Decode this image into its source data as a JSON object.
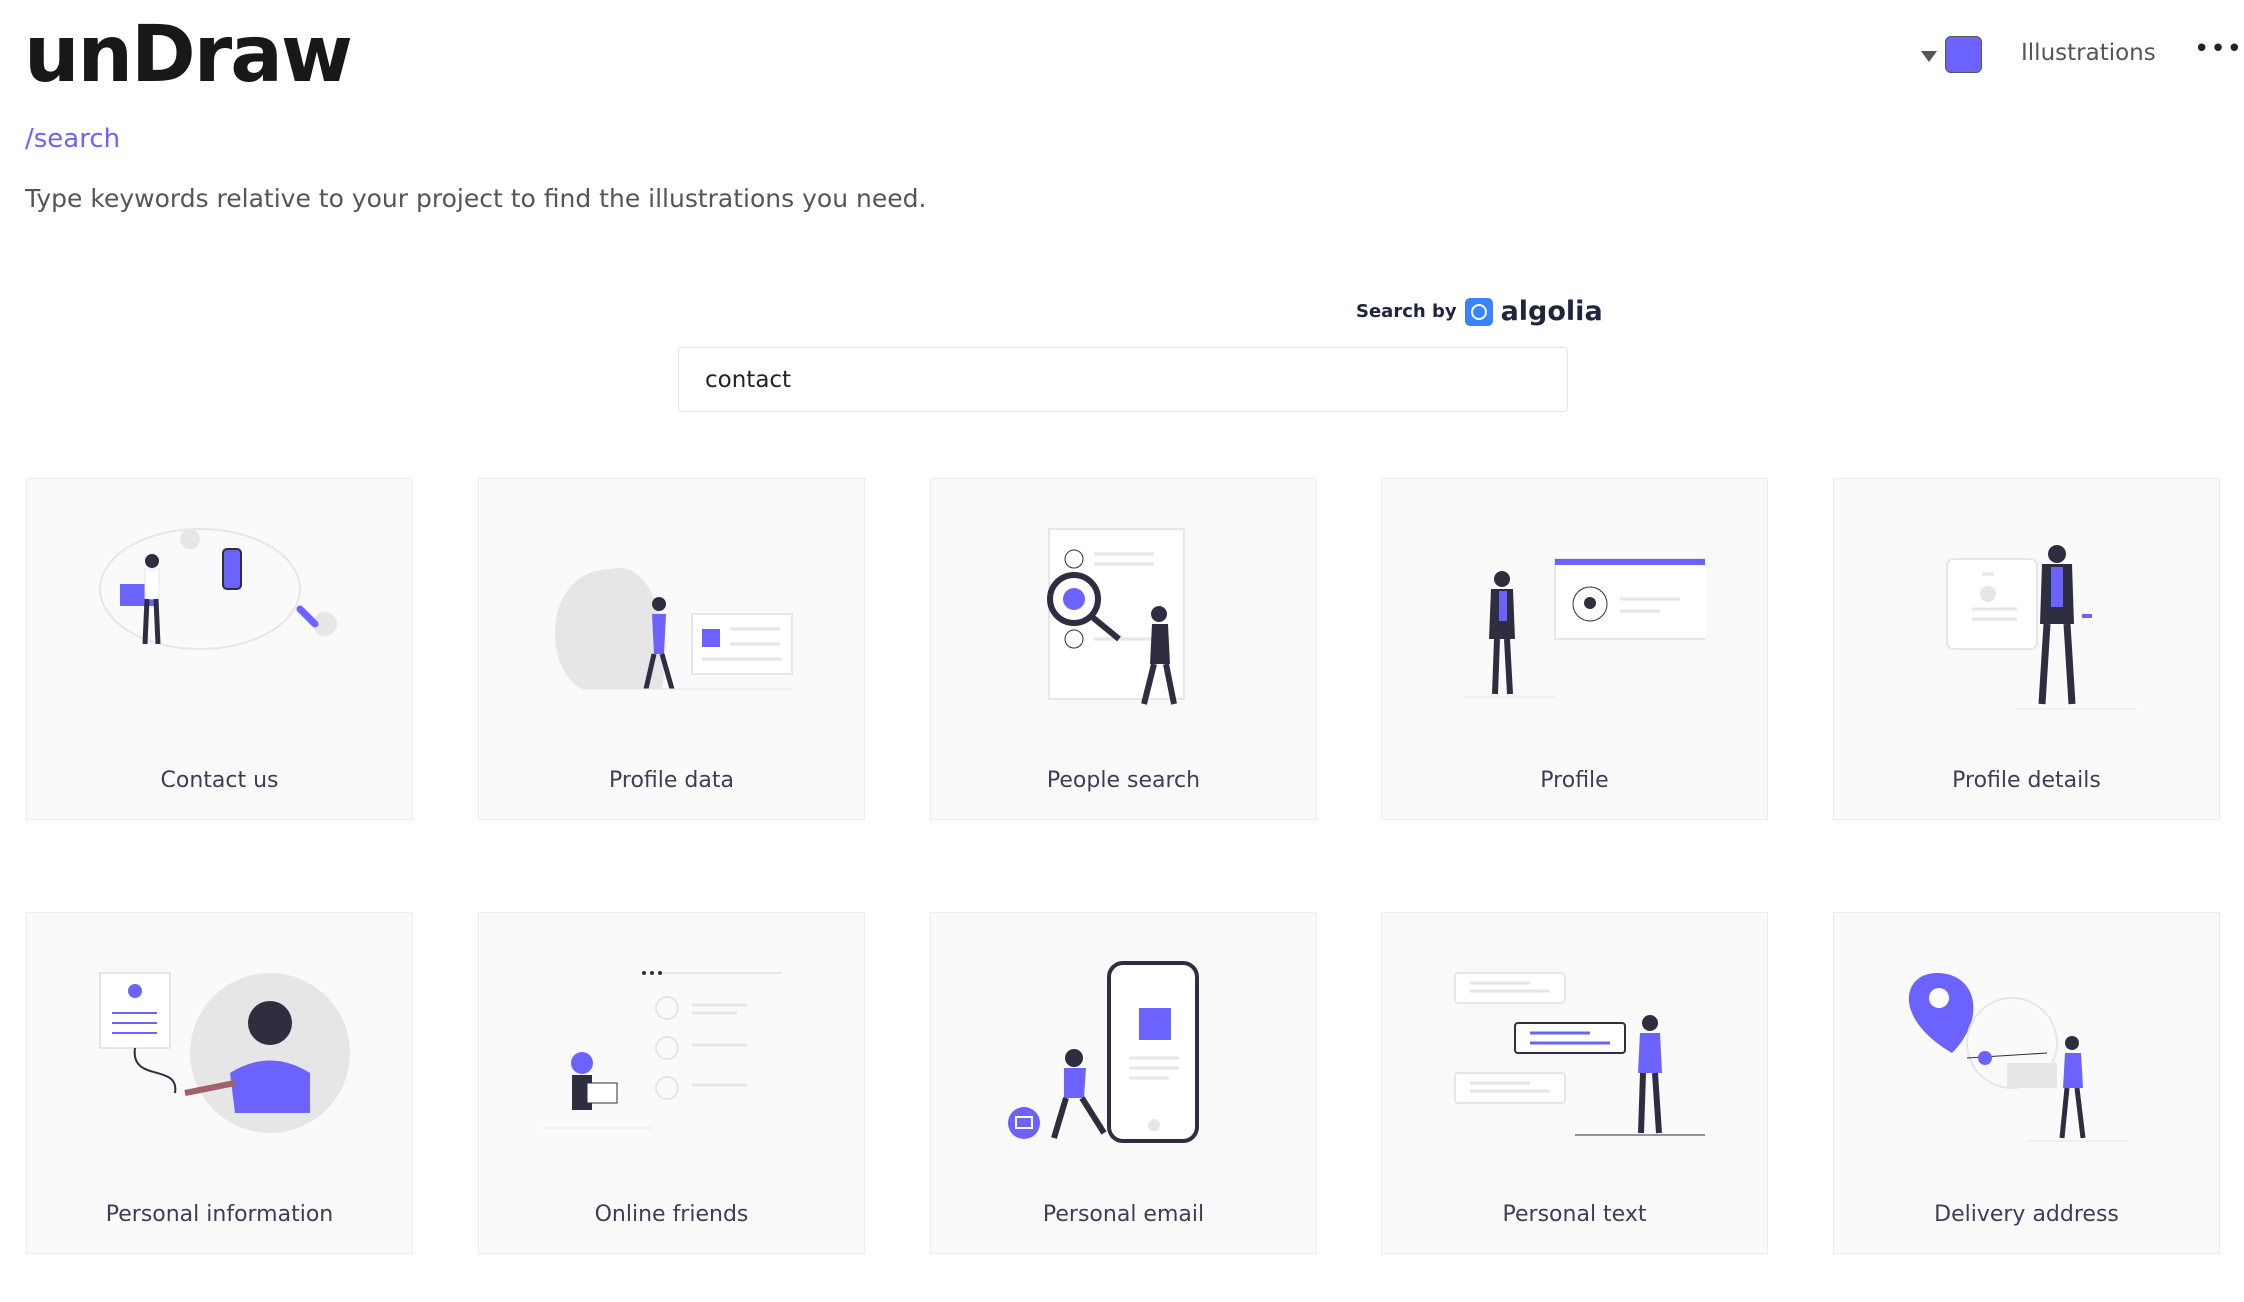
{
  "header": {
    "logo": "unDraw",
    "breadcrumb": "/search",
    "description": "Type keywords relative to your project to find the illustrations you need.",
    "accent_color": "#6c63ff",
    "nav_label": "Illustrations",
    "more_icon": "ellipsis-icon",
    "color_dropdown_icon": "caret-down-icon"
  },
  "search": {
    "powered_by": "Search by",
    "provider": "algolia",
    "value": "contact"
  },
  "results": [
    {
      "title": "Contact us"
    },
    {
      "title": "Profile data"
    },
    {
      "title": "People search"
    },
    {
      "title": "Profile"
    },
    {
      "title": "Profile details"
    },
    {
      "title": "Personal information"
    },
    {
      "title": "Online friends"
    },
    {
      "title": "Personal email"
    },
    {
      "title": "Personal text"
    },
    {
      "title": "Delivery address"
    }
  ]
}
